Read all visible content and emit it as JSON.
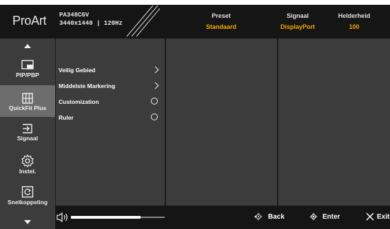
{
  "header": {
    "brand": "ProArt",
    "model": "PA348CGV",
    "resolution": "3440x1440 | 120Hz",
    "columns": [
      {
        "label": "Preset",
        "value": "Standaard"
      },
      {
        "label": "Signaal",
        "value": "DisplayPort"
      },
      {
        "label": "Helderheid",
        "value": "100"
      }
    ]
  },
  "sidebar": {
    "items": [
      {
        "label": "PIP/PBP",
        "icon": "pip-icon"
      },
      {
        "label": "QuickFit Plus",
        "icon": "grid-icon",
        "active": true
      },
      {
        "label": "Signaal",
        "icon": "input-icon"
      },
      {
        "label": "Instel.",
        "icon": "gear-icon"
      },
      {
        "label": "Snelkoppeling",
        "icon": "shortcut-icon"
      }
    ]
  },
  "menu": {
    "items": [
      {
        "label": "Veilig Gebied",
        "type": "submenu"
      },
      {
        "label": "Middelste Markering",
        "type": "submenu"
      },
      {
        "label": "Customization",
        "type": "radio"
      },
      {
        "label": "Ruler",
        "type": "radio"
      }
    ]
  },
  "footer": {
    "volume_level": 0.74,
    "back_label": "Back",
    "enter_label": "Enter",
    "exit_label": "Exit"
  },
  "colors": {
    "accent": "#f2a900",
    "panel": "#3c3c3c",
    "header": "#151515",
    "active": "#6d6d6d"
  }
}
